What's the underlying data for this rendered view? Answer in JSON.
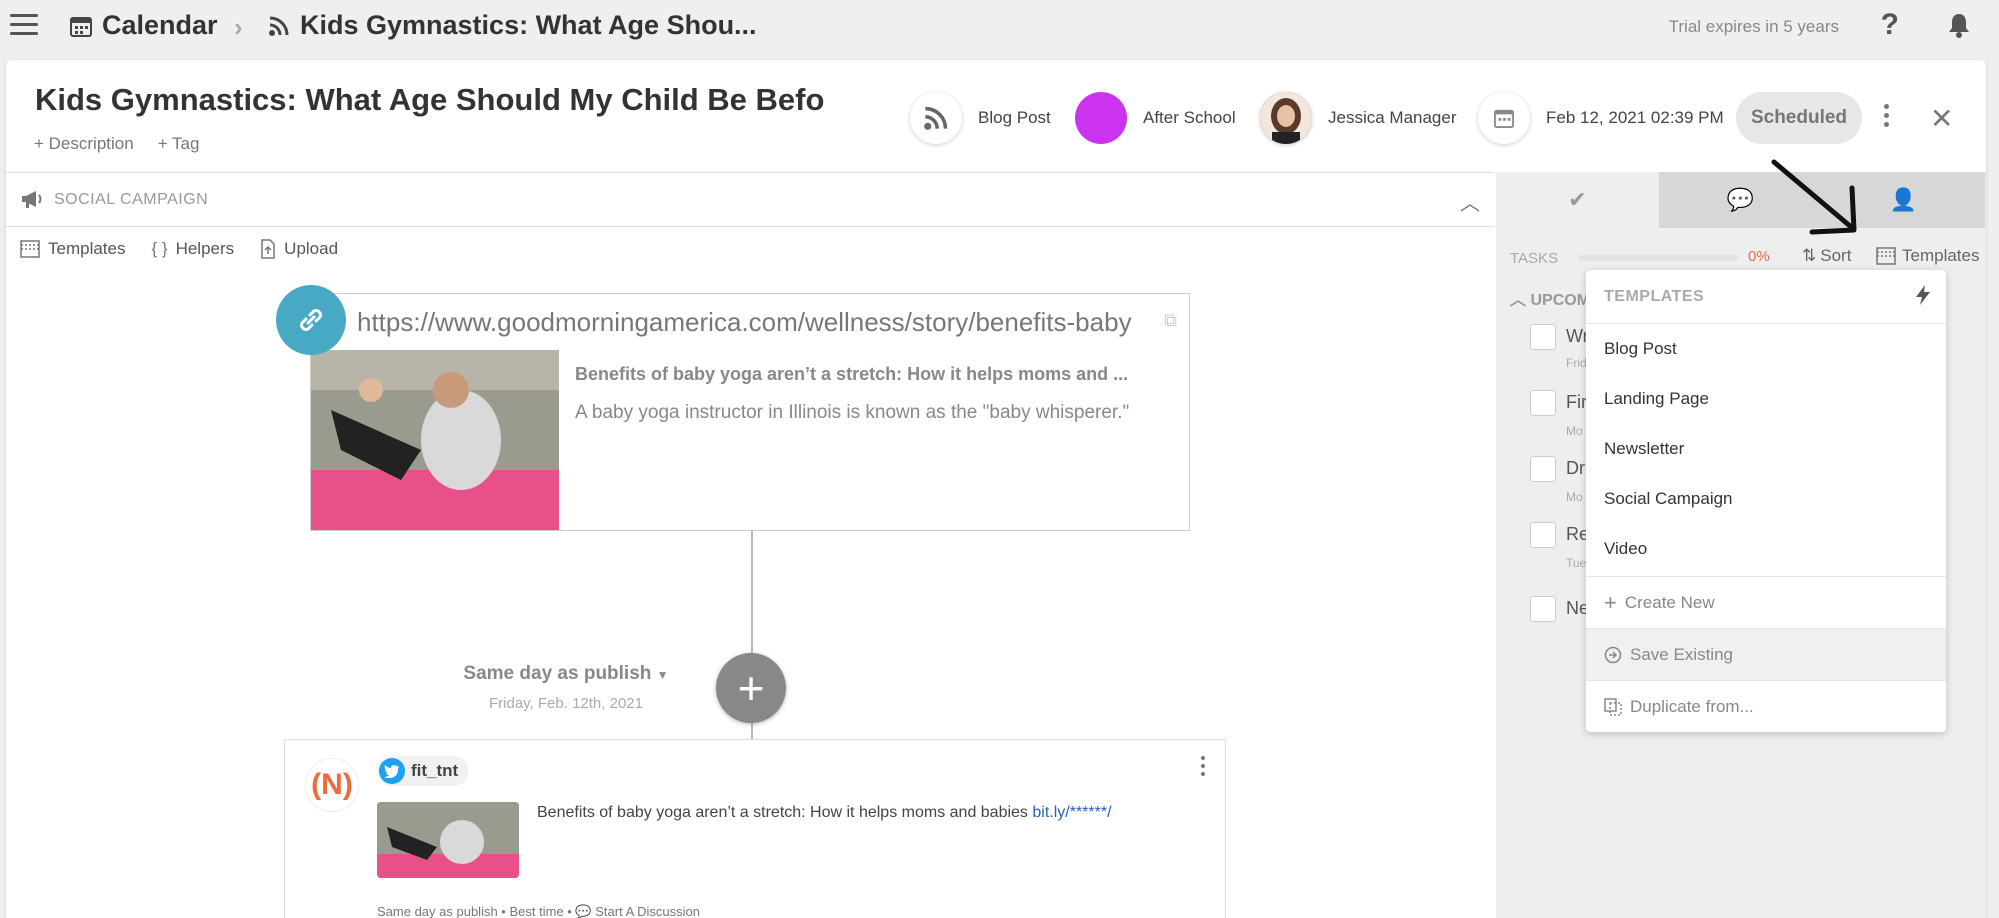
{
  "topbar": {
    "calendar_label": "Calendar",
    "post_crumb": "Kids Gymnastics: What Age Shou...",
    "trial_text": "Trial expires in 5 years",
    "help_glyph": "?"
  },
  "header": {
    "title": "Kids Gymnastics: What Age Should My Child Be Befo",
    "description_link": "+ Description",
    "tag_link": "+ Tag",
    "type_label": "Blog Post",
    "campaign_label": "After School",
    "campaign_color": "#cc33ee",
    "owner_label": "Jessica Manager",
    "date_label": "Feb 12, 2021 02:39 PM",
    "status_label": "Scheduled"
  },
  "social": {
    "section_label": "SOCIAL CAMPAIGN",
    "toolbar": {
      "templates": "Templates",
      "helpers_braces": "{ }",
      "helpers": "Helpers",
      "upload": "Upload"
    },
    "preview": {
      "url": "https://www.goodmorningamerica.com/wellness/story/benefits-baby",
      "title": "Benefits of baby yoga aren’t a stretch: How it helps moms and ...",
      "description": "A baby yoga instructor in Illinois is known as the \"baby whisperer.\""
    },
    "schedule": {
      "label": "Same day as publish",
      "date": "Friday, Feb. 12th, 2021"
    },
    "post": {
      "avatar_text": "(N)",
      "handle": "fit_tnt",
      "text": "Benefits of baby yoga aren’t a stretch: How it helps moms and babies ",
      "link": "bit.ly/******/",
      "footer": "Same day as publish • Best time • ",
      "discussion": "Start A Discussion"
    }
  },
  "tasks": {
    "label": "TASKS",
    "progress_percent": 0,
    "progress_text": "0%",
    "sort_label": "Sort",
    "templates_label": "Templates",
    "upcoming_label": "UPCOM",
    "items": [
      {
        "label": "Wr",
        "sub": "Frid"
      },
      {
        "label": "Fir",
        "sub": "Mo"
      },
      {
        "label": "Dr",
        "sub": "Mo"
      },
      {
        "label": "Re",
        "sub": "Tue"
      },
      {
        "label": "Ne",
        "sub": ""
      }
    ]
  },
  "templates_dropdown": {
    "header": "TEMPLATES",
    "items": [
      "Blog Post",
      "Landing Page",
      "Newsletter",
      "Social Campaign",
      "Video"
    ],
    "create_new": "Create New",
    "save_existing": "Save Existing",
    "duplicate_from": "Duplicate from..."
  }
}
